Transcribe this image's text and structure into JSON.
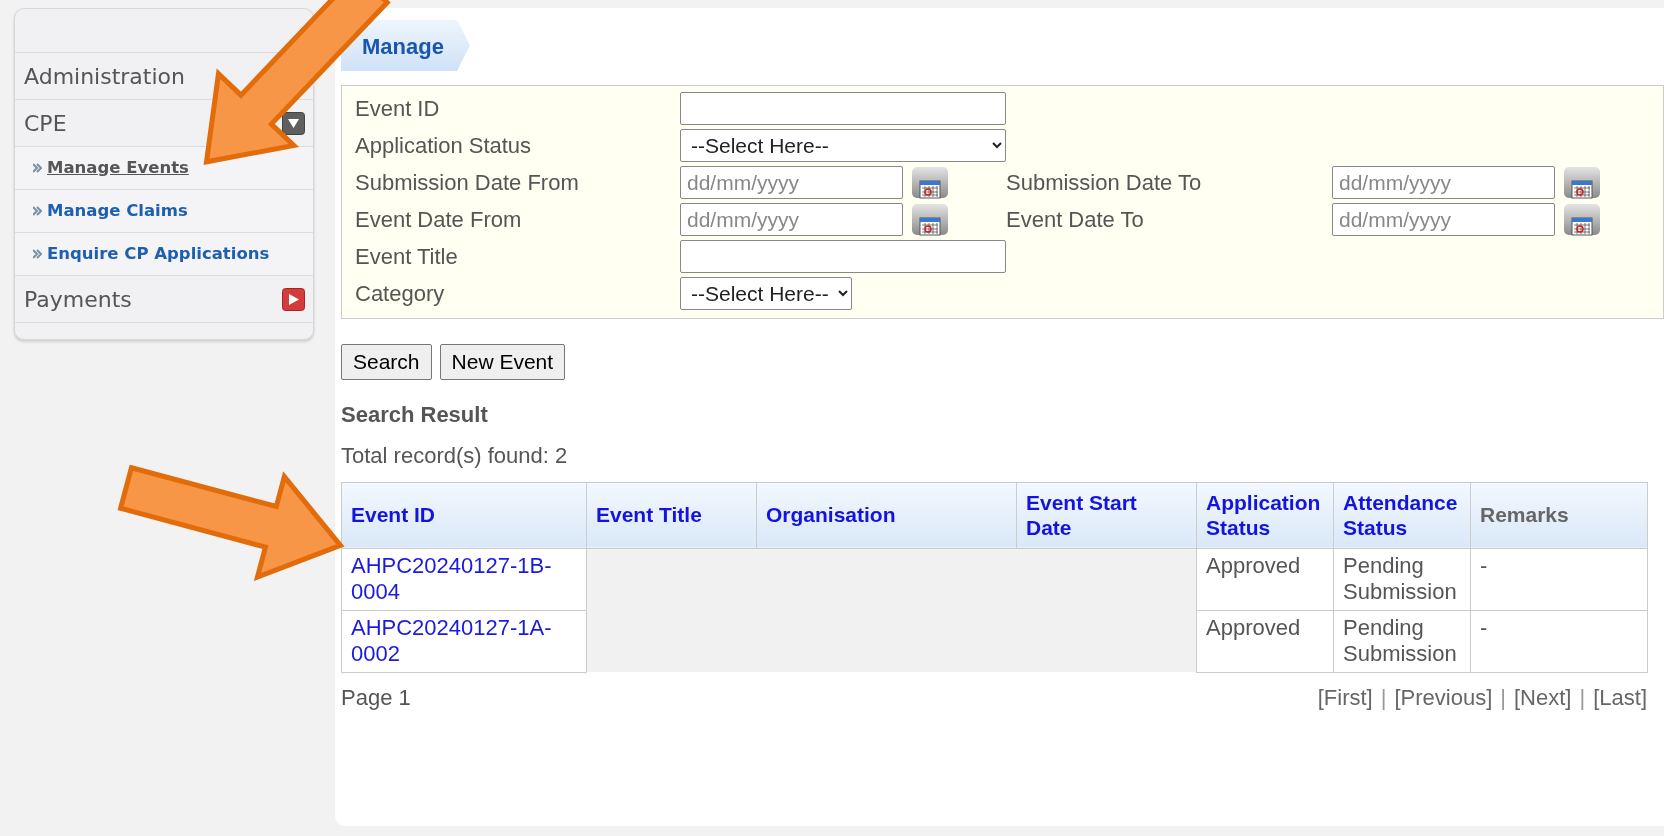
{
  "sidebar": {
    "items": [
      {
        "label": "Administration",
        "kind": "plain"
      },
      {
        "label": "CPE",
        "kind": "toggle",
        "expanded": true,
        "children": [
          {
            "label": "Manage Events",
            "selected": true
          },
          {
            "label": "Manage Claims",
            "selected": false
          },
          {
            "label": "Enquire CP Applications",
            "selected": false
          }
        ]
      },
      {
        "label": "Payments",
        "kind": "toggle",
        "expanded": false
      }
    ]
  },
  "page_tab": {
    "label": "Manage"
  },
  "search_form": {
    "rows": [
      [
        {
          "label": "Event ID",
          "kind": "text"
        }
      ],
      [
        {
          "label": "Application Status",
          "kind": "select",
          "value": "--Select Here--"
        }
      ],
      [
        {
          "label": "Submission Date From",
          "kind": "date",
          "placeholder": "dd/mm/yyyy"
        },
        {
          "label": "Submission Date To",
          "kind": "date",
          "placeholder": "dd/mm/yyyy"
        }
      ],
      [
        {
          "label": "Event Date From",
          "kind": "date",
          "placeholder": "dd/mm/yyyy"
        },
        {
          "label": "Event Date To",
          "kind": "date",
          "placeholder": "dd/mm/yyyy"
        }
      ],
      [
        {
          "label": "Event Title",
          "kind": "text"
        }
      ],
      [
        {
          "label": "Category",
          "kind": "select",
          "value": "--Select Here--"
        }
      ]
    ]
  },
  "buttons": [
    "Search",
    "New Event"
  ],
  "results": {
    "title": "Search Result",
    "total": "Total record(s) found: 2",
    "columns": [
      {
        "label": "Event ID",
        "link": true
      },
      {
        "label": "Event Title",
        "link": true
      },
      {
        "label": "Organisation",
        "link": true
      },
      {
        "label": "Event Start Date",
        "link": true
      },
      {
        "label": "Application Status",
        "link": true
      },
      {
        "label": "Attendance Status",
        "link": true
      },
      {
        "label": "Remarks",
        "link": false
      }
    ],
    "rows": [
      {
        "cells": [
          "AHPC20240127-1B-0004",
          null,
          null,
          null,
          "Approved",
          "Pending Submission",
          "-"
        ]
      },
      {
        "cells": [
          "AHPC20240127-1A-0002",
          null,
          null,
          null,
          "Approved",
          "Pending Submission",
          "-"
        ]
      }
    ],
    "page": "Page 1",
    "pager": [
      {
        "label": "[First]",
        "kind": "link"
      },
      {
        "label": "|",
        "kind": "separator"
      },
      {
        "label": "[Previous]",
        "kind": "link"
      },
      {
        "label": "|",
        "kind": "separator"
      },
      {
        "label": "[Next]",
        "kind": "link"
      },
      {
        "label": "|",
        "kind": "separator"
      },
      {
        "label": "[Last]",
        "kind": "link"
      }
    ]
  },
  "annotation_arrows": [
    {
      "kind": "down-left"
    },
    {
      "kind": "right"
    }
  ]
}
